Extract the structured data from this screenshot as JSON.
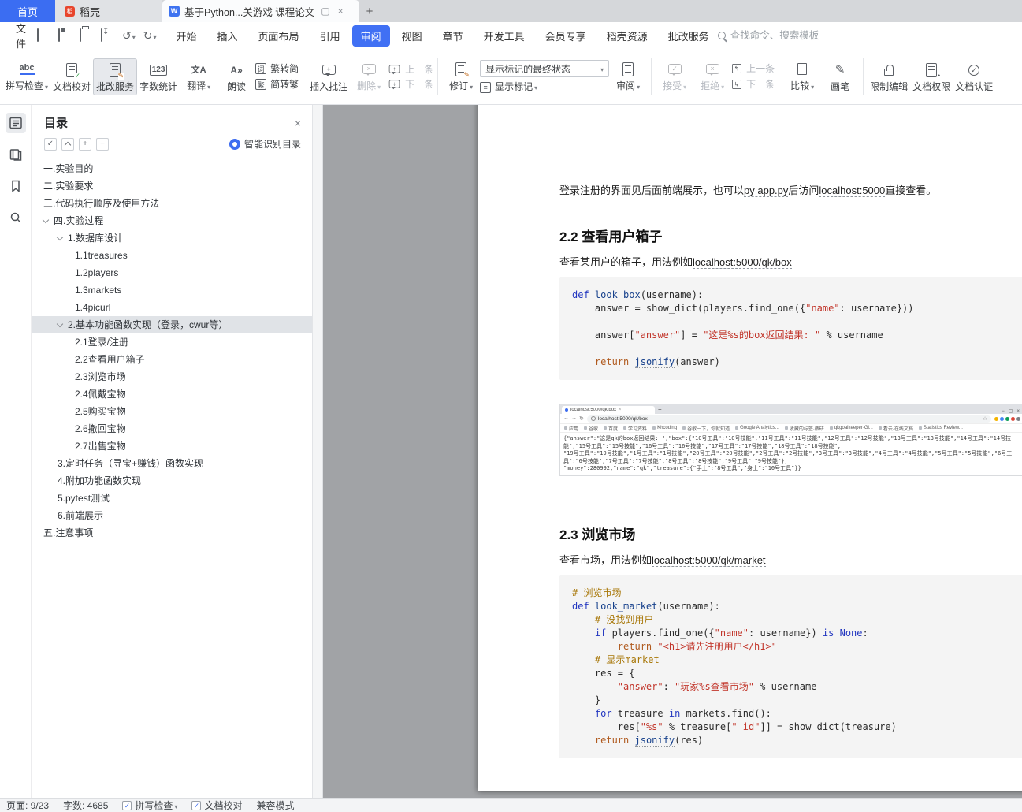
{
  "icons": {
    "dropdown_caret": "▾",
    "close": "×",
    "plus": "+",
    "minus": "−",
    "check": "✓",
    "undo": "↺",
    "redo": "↻",
    "back": "←",
    "forward": "→",
    "reload": "↻",
    "star": "☆",
    "more": "⋮",
    "minimize": "−",
    "restore": "▢"
  },
  "tabbar": {
    "home": "首页",
    "docer": "稻壳",
    "docer_logo": "稻",
    "w_logo": "W",
    "doc_title": "基于Python...关游戏 课程论文"
  },
  "menubar": {
    "file": "文件",
    "tabs": [
      "开始",
      "插入",
      "页面布局",
      "引用",
      "审阅",
      "视图",
      "章节",
      "开发工具",
      "会员专享",
      "稻壳资源",
      "批改服务"
    ],
    "active_tab": "审阅",
    "search_placeholder": "查找命令、搜索模板"
  },
  "ribbon": {
    "spell_check": "拼写检查",
    "doc_proof": "文档校对",
    "correction_service": "批改服务",
    "word_count": "字数统计",
    "translate": "翻译",
    "read_aloud": "朗读",
    "trad_to_simp": "繁转简",
    "simp_to_trad": "简转繁",
    "boxed_ci": "词",
    "boxed_fan": "繁",
    "insert_comment": "插入批注",
    "delete": "删除",
    "prev_comment": "上一条",
    "next_comment": "下一条",
    "track_changes": "修订",
    "markup_state": "显示标记的最终状态",
    "show_markup": "显示标记",
    "review": "审阅",
    "accept": "接受",
    "reject": "拒绝",
    "prev_change": "上一条",
    "next_change": "下一条",
    "compare": "比较",
    "brush": "画笔",
    "restrict_edit": "限制编辑",
    "doc_permission": "文档权限",
    "doc_certify": "文档认证",
    "icon_abc": "abc",
    "icon_123": "123",
    "icon_trans": "文A",
    "icon_read": "A»"
  },
  "toc": {
    "title": "目录",
    "smart_recognize": "智能识别目录",
    "items": [
      {
        "label": "一.实验目的",
        "level": 1
      },
      {
        "label": "二.实验要求",
        "level": 1
      },
      {
        "label": "三.代码执行顺序及使用方法",
        "level": 1
      },
      {
        "label": "四.实验过程",
        "level": 1,
        "expanded": true
      },
      {
        "label": "1.数据库设计",
        "level": 2,
        "expanded": true
      },
      {
        "label": "1.1treasures",
        "level": 3
      },
      {
        "label": "1.2players",
        "level": 3
      },
      {
        "label": "1.3markets",
        "level": 3
      },
      {
        "label": "1.4picurl",
        "level": 3
      },
      {
        "label": "2.基本功能函数实现（登录，cwur等）",
        "level": 2,
        "expanded": true,
        "selected": true
      },
      {
        "label": "2.1登录/注册",
        "level": 3
      },
      {
        "label": "2.2查看用户箱子",
        "level": 3
      },
      {
        "label": "2.3浏览市场",
        "level": 3
      },
      {
        "label": "2.4佩戴宝物",
        "level": 3
      },
      {
        "label": "2.5购买宝物",
        "level": 3
      },
      {
        "label": "2.6撤回宝物",
        "level": 3
      },
      {
        "label": "2.7出售宝物",
        "level": 3
      },
      {
        "label": "3.定时任务（寻宝+赚钱）函数实现",
        "level": 2
      },
      {
        "label": "4.附加功能函数实现",
        "level": 2
      },
      {
        "label": "5.pytest测试",
        "level": 2
      },
      {
        "label": "6.前端展示",
        "level": 2
      },
      {
        "label": "五.注意事项",
        "level": 1
      }
    ]
  },
  "doc": {
    "para_intro": [
      {
        "t": "登录注册的界面见后面前端展示，也可以"
      },
      {
        "t": "py app.py",
        "u": true
      },
      {
        "t": "后访问"
      },
      {
        "t": "localhost:5000",
        "u": true
      },
      {
        "t": "直接查看。"
      }
    ],
    "heading_22": "2.2 查看用户箱子",
    "para_22": [
      {
        "t": "查看某用户的箱子，用法例如"
      },
      {
        "t": "localhost:5000/qk/box",
        "u": true
      }
    ],
    "code1": [
      [
        {
          "t": "def ",
          "c": "kw"
        },
        {
          "t": "look_box",
          "c": "fn"
        },
        {
          "t": "(username):",
          "c": "pl"
        }
      ],
      [
        {
          "t": "    answer = show_dict(players.find_one({",
          "c": "pl"
        },
        {
          "t": "\"name\"",
          "c": "str"
        },
        {
          "t": ": username}))",
          "c": "pl"
        }
      ],
      [],
      [
        {
          "t": "    answer[",
          "c": "pl"
        },
        {
          "t": "\"answer\"",
          "c": "str"
        },
        {
          "t": "] = ",
          "c": "pl"
        },
        {
          "t": "\"这是%s的box返回结果: \"",
          "c": "str"
        },
        {
          "t": " % username",
          "c": "pl"
        }
      ],
      [],
      [
        {
          "t": "    ",
          "c": "pl"
        },
        {
          "t": "return",
          "c": "kw2"
        },
        {
          "t": " ",
          "c": "pl"
        },
        {
          "t": "jsonify",
          "c": "fn",
          "u": true
        },
        {
          "t": "(answer)",
          "c": "pl"
        }
      ]
    ],
    "shot": {
      "tab_title": "localhost:5000/qk/box",
      "url": "localhost:5000/qk/box",
      "bookmarks": [
        "应用",
        "谷歌",
        "百度",
        "学习资料",
        "Khcoding",
        "谷歌一下，你就知道",
        "Google Analytics...",
        "收藏的标签·教研",
        "qkgoalkeeper·Gi...",
        "看云·在线文档",
        "Statistics Review..."
      ],
      "body_lines": [
        "{\"answer\":\"这是qk的box返回结果: \",\"box\":{\"10号工具\":\"10号技能\",\"11号工具\":\"11号技能\",\"12号工具\":\"12号技能\",\"13号工具\":\"13号技能\",\"14号工具\":\"14号技能\",\"15号工具\":\"15号技能\",\"16号工具\":\"16号技能\",\"17号工具\":\"17号技能\",\"18号工具\":\"18号技能\",",
        "\"19号工具\":\"19号技能\",\"1号工具\":\"1号技能\",\"20号工具\":\"20号技能\",\"2号工具\":\"2号技能\",\"3号工具\":\"3号技能\",\"4号工具\":\"4号技能\",\"5号工具\":\"5号技能\",\"6号工具\":\"6号技能\",\"7号工具\":\"7号技能\",\"8号工具\":\"8号技能\",\"9号工具\":\"9号技能\"},",
        "\"money\":280992,\"name\":\"qk\",\"treasure\":{\"手上\":\"8号工具\",\"身上\":\"10号工具\"}}"
      ]
    },
    "heading_23": "2.3 浏览市场",
    "para_23": [
      {
        "t": "查看市场，用法例如"
      },
      {
        "t": "localhost:5000/qk/market",
        "u": true
      }
    ],
    "code2": [
      [
        {
          "t": "# 浏览市场",
          "c": "cm"
        }
      ],
      [
        {
          "t": "def ",
          "c": "kw"
        },
        {
          "t": "look_market",
          "c": "fn"
        },
        {
          "t": "(username):",
          "c": "pl"
        }
      ],
      [
        {
          "t": "    ",
          "c": "pl"
        },
        {
          "t": "# 没找到用户",
          "c": "cm"
        }
      ],
      [
        {
          "t": "    ",
          "c": "pl"
        },
        {
          "t": "if",
          "c": "kw"
        },
        {
          "t": " players.find_one({",
          "c": "pl"
        },
        {
          "t": "\"name\"",
          "c": "str"
        },
        {
          "t": ": username}) ",
          "c": "pl"
        },
        {
          "t": "is",
          "c": "kw"
        },
        {
          "t": " ",
          "c": "pl"
        },
        {
          "t": "None",
          "c": "kw"
        },
        {
          "t": ":",
          "c": "pl"
        }
      ],
      [
        {
          "t": "        ",
          "c": "pl"
        },
        {
          "t": "return",
          "c": "kw2"
        },
        {
          "t": " ",
          "c": "pl"
        },
        {
          "t": "\"<h1>请先注册用户</h1>\"",
          "c": "str"
        }
      ],
      [
        {
          "t": "    ",
          "c": "pl"
        },
        {
          "t": "# 显示market",
          "c": "cm"
        }
      ],
      [
        {
          "t": "    res = {",
          "c": "pl"
        }
      ],
      [
        {
          "t": "        ",
          "c": "pl"
        },
        {
          "t": "\"answer\"",
          "c": "str"
        },
        {
          "t": ": ",
          "c": "pl"
        },
        {
          "t": "\"玩家%s查看市场\"",
          "c": "str"
        },
        {
          "t": " % username",
          "c": "pl"
        }
      ],
      [
        {
          "t": "    }",
          "c": "pl"
        }
      ],
      [
        {
          "t": "    ",
          "c": "pl"
        },
        {
          "t": "for",
          "c": "kw"
        },
        {
          "t": " treasure ",
          "c": "pl"
        },
        {
          "t": "in",
          "c": "kw"
        },
        {
          "t": " markets.find():",
          "c": "pl"
        }
      ],
      [
        {
          "t": "        res[",
          "c": "pl"
        },
        {
          "t": "\"%s\"",
          "c": "str"
        },
        {
          "t": " % treasure[",
          "c": "pl"
        },
        {
          "t": "\"_id\"",
          "c": "str"
        },
        {
          "t": "]] = show_dict(treasure)",
          "c": "pl"
        }
      ],
      [
        {
          "t": "    ",
          "c": "pl"
        },
        {
          "t": "return",
          "c": "kw2"
        },
        {
          "t": " ",
          "c": "pl"
        },
        {
          "t": "jsonify",
          "c": "fn",
          "u": true
        },
        {
          "t": "(res)",
          "c": "pl"
        }
      ]
    ]
  },
  "statusbar": {
    "page": "页面: 9/23",
    "words": "字数: 4685",
    "spell_check": "拼写检查",
    "doc_proof": "文档校对",
    "compat_mode": "兼容模式"
  }
}
